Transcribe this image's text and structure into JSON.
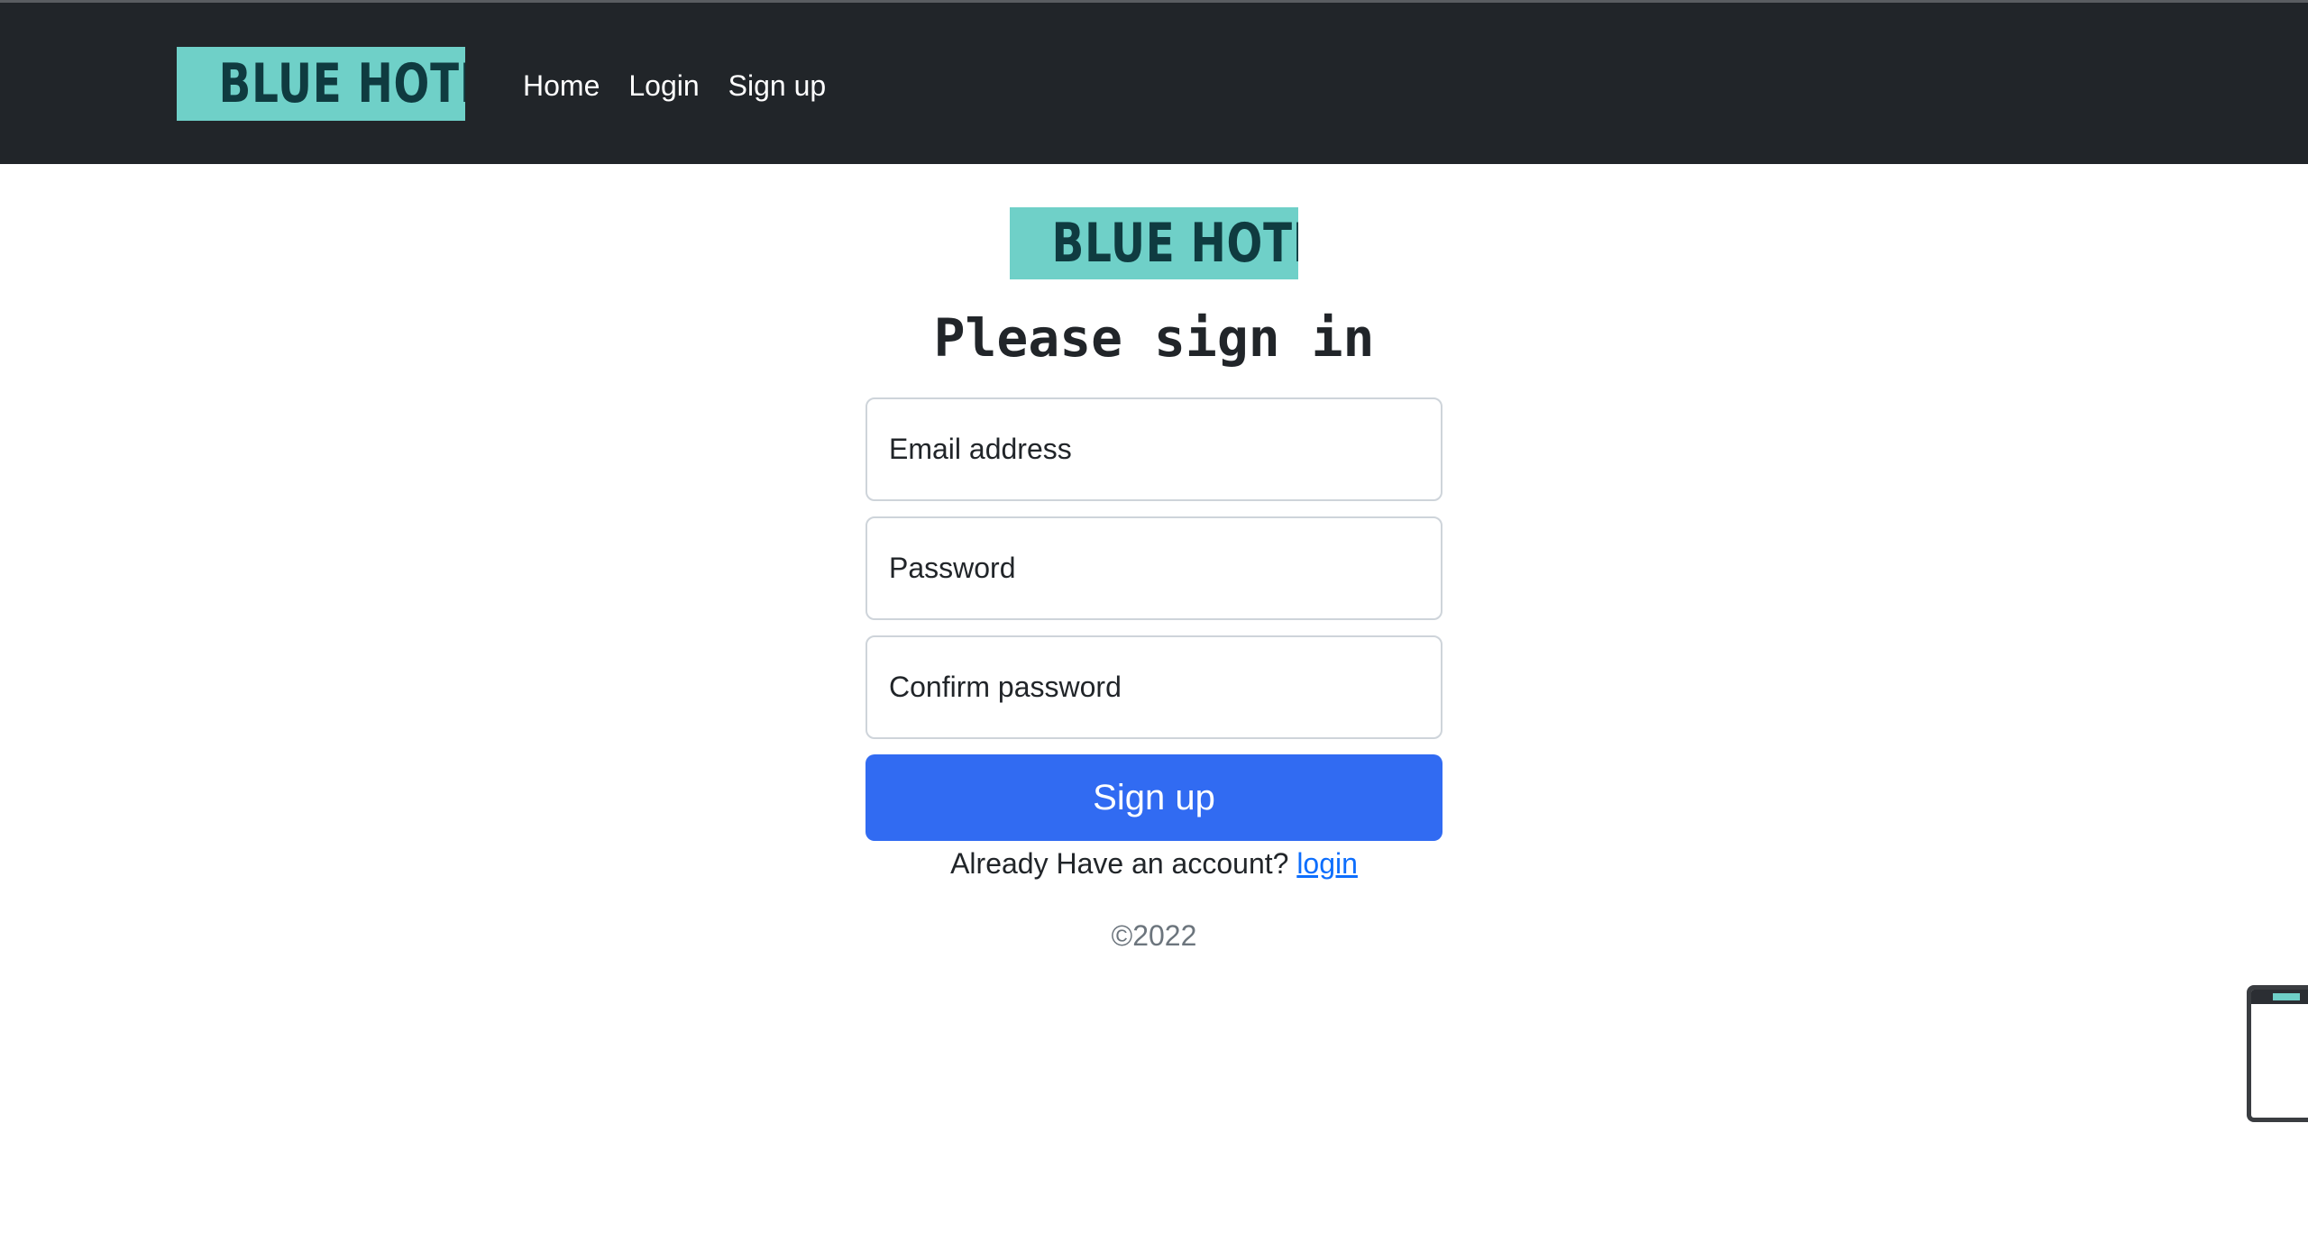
{
  "navbar": {
    "logo_text": "BLUE HOTEL",
    "links": [
      {
        "label": "Home"
      },
      {
        "label": "Login"
      },
      {
        "label": "Sign up"
      }
    ]
  },
  "main": {
    "logo_text": "BLUE HOTEL",
    "title": "Please sign in",
    "email_placeholder": "Email address",
    "password_placeholder": "Password",
    "confirm_placeholder": "Confirm password",
    "submit_label": "Sign up",
    "account_prompt": "Already Have an account?",
    "login_link": "login",
    "copyright": "©2022"
  },
  "colors": {
    "navbar_bg": "#212529",
    "logo_bg": "#6fd0c8",
    "logo_text": "#0f3b40",
    "primary_button": "#316bf2",
    "link": "#0d6efd",
    "muted_text": "#6c757d"
  }
}
